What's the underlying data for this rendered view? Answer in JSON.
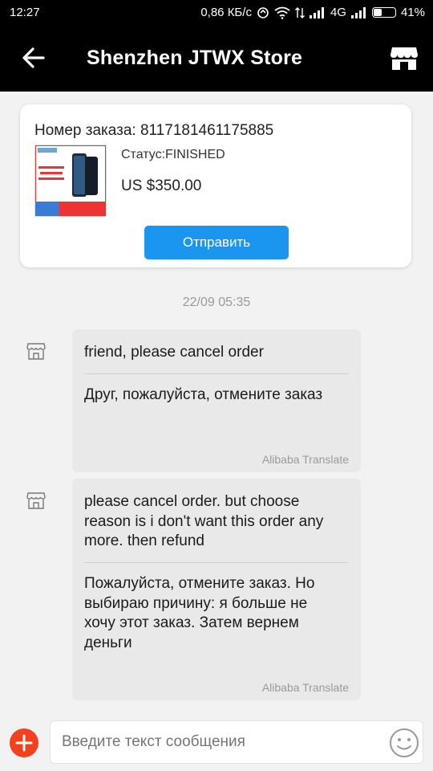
{
  "status_bar": {
    "time": "12:27",
    "speed": "0,86 КБ/с",
    "network": "4G",
    "battery": "41%",
    "battery_level": 0.41
  },
  "header": {
    "title": "Shenzhen JTWX Store",
    "back_icon": "arrow-left-icon",
    "store_icon": "store-icon"
  },
  "order": {
    "number_label": "Номер заказа: 8117181461175885",
    "status_label": "Статус:FINISHED",
    "price": "US $350.00",
    "send_button": "Отправить",
    "thumb_badge": "Original In Stock"
  },
  "chat": {
    "timestamp": "22/09 05:35",
    "messages": [
      {
        "original": "friend, please cancel order",
        "translation": "Друг, пожалуйста, отмените заказ",
        "translator": "Alibaba Translate"
      },
      {
        "original": "please cancel order.  but choose reason is i don't want this order any more. then refund",
        "translation": "Пожалуйста, отмените заказ. Но выбираю причину: я больше не хочу этот заказ. Затем вернем деньги",
        "translator": "Alibaba Translate"
      }
    ]
  },
  "input": {
    "placeholder": "Введите текст сообщения"
  },
  "colors": {
    "accent": "#1a95f0",
    "plus": "#f2411c",
    "bubble": "#e9e9e9"
  }
}
